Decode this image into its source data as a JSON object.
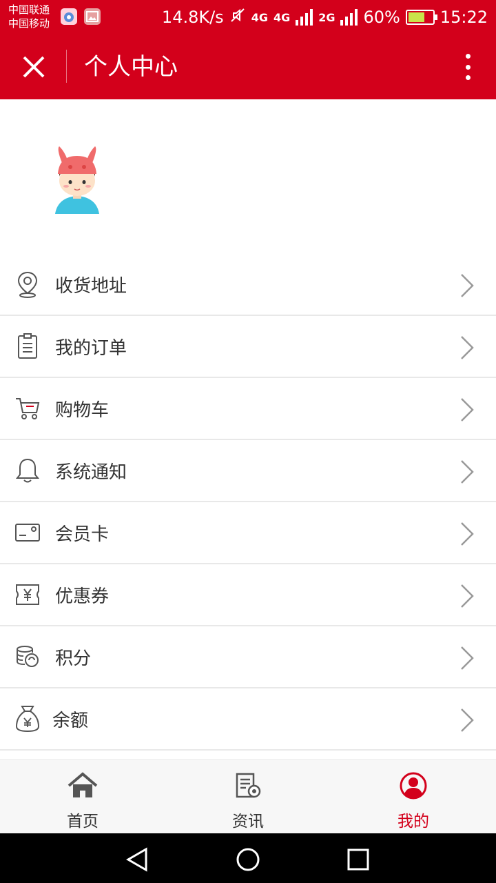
{
  "status_bar": {
    "carrier1": "中国联通",
    "carrier2": "中国移动",
    "speed": "14.8K/s",
    "net1": "4G",
    "net2": "4G",
    "net3": "2G",
    "battery": "60%",
    "time": "15:22"
  },
  "header": {
    "title": "个人中心"
  },
  "menu": {
    "items": [
      {
        "label": "收货地址",
        "icon": "location-icon"
      },
      {
        "label": "我的订单",
        "icon": "clipboard-icon"
      },
      {
        "label": "购物车",
        "icon": "cart-icon"
      },
      {
        "label": "系统通知",
        "icon": "bell-icon"
      },
      {
        "label": "会员卡",
        "icon": "card-icon"
      },
      {
        "label": "优惠券",
        "icon": "coupon-icon"
      },
      {
        "label": "积分",
        "icon": "coins-icon"
      },
      {
        "label": "余额",
        "icon": "money-bag-icon"
      }
    ]
  },
  "bottom_nav": {
    "items": [
      {
        "label": "首页",
        "icon": "home-icon"
      },
      {
        "label": "资讯",
        "icon": "news-icon"
      },
      {
        "label": "我的",
        "icon": "user-icon",
        "active": true
      }
    ]
  },
  "colors": {
    "brand": "#d3001b",
    "text": "#333333",
    "divider": "#e8e8e8"
  }
}
